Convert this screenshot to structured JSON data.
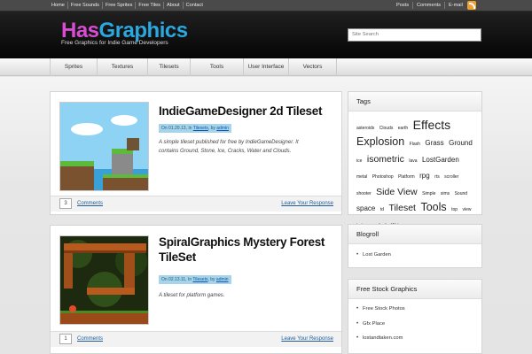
{
  "topnav": [
    "Home",
    "Free Sounds",
    "Free Sprites",
    "Free Tiles",
    "About",
    "Contact"
  ],
  "topnav_right": [
    "Posts",
    "Comments",
    "E-mail"
  ],
  "logo": {
    "part1": "Has",
    "part2": "Graphics",
    "tagline": "Free Graphics for Indie Game Developers"
  },
  "search": {
    "placeholder": "Site Search"
  },
  "nav": [
    "Sprites",
    "Textures",
    "Tilesets",
    "Tools",
    "User Interface",
    "Vectors"
  ],
  "posts": [
    {
      "title": "IndieGameDesigner 2d Tileset",
      "date": "On 01.20.13,",
      "in_label": "In",
      "category": "Tilesets",
      "by_label": ", by",
      "author": "admin",
      "excerpt": "A simple tileset published for free by IndieGameDesigner. It contains Ground, Stone, Ice, Cracks, Water and Clouds.",
      "comment_count": "3",
      "comments_label": "Comments",
      "leave_label": "Leave Your Response"
    },
    {
      "title": "SpiralGraphics Mystery Forest TileSet",
      "date": "On 02.13.11,",
      "in_label": "In",
      "category": "Tilesets",
      "by_label": ", by",
      "author": "admin",
      "excerpt": "A tileset for platform games.",
      "comment_count": "1",
      "comments_label": "Comments",
      "leave_label": "Leave Your Response"
    }
  ],
  "sidebar": {
    "tags_title": "Tags",
    "tags": [
      {
        "t": "asteroids",
        "s": 1
      },
      {
        "t": "Clouds",
        "s": 1
      },
      {
        "t": "earth",
        "s": 1
      },
      {
        "t": "Effects",
        "s": 5
      },
      {
        "t": "Explosion",
        "s": 4
      },
      {
        "t": "Flash",
        "s": 1
      },
      {
        "t": "Grass",
        "s": 2
      },
      {
        "t": "Ground",
        "s": 2
      },
      {
        "t": "ice",
        "s": 1
      },
      {
        "t": "isometric",
        "s": 3
      },
      {
        "t": "lava",
        "s": 1
      },
      {
        "t": "LostGarden",
        "s": 2
      },
      {
        "t": "metal",
        "s": 1
      },
      {
        "t": "Photoshop",
        "s": 1
      },
      {
        "t": "Platform",
        "s": 1
      },
      {
        "t": "rpg",
        "s": 2
      },
      {
        "t": "rts",
        "s": 1
      },
      {
        "t": "scroller",
        "s": 1
      },
      {
        "t": "shooter",
        "s": 1
      },
      {
        "t": "Side View",
        "s": 3
      },
      {
        "t": "Simple",
        "s": 1
      },
      {
        "t": "sims",
        "s": 1
      },
      {
        "t": "Sound",
        "s": 1
      },
      {
        "t": "space",
        "s": 2
      },
      {
        "t": "td",
        "s": 1
      },
      {
        "t": "Tileset",
        "s": 3
      },
      {
        "t": "Tools",
        "s": 4
      },
      {
        "t": "top",
        "s": 1
      },
      {
        "t": "view",
        "s": 1
      },
      {
        "t": "tyrian",
        "s": 1
      },
      {
        "t": "vertical",
        "s": 1
      },
      {
        "t": "Water",
        "s": 1
      }
    ],
    "blogroll_title": "Blogroll",
    "blogroll": [
      "Lost Garden"
    ],
    "stock_title": "Free Stock Graphics",
    "stock": [
      "Free Stock Photos",
      "Gfx Place",
      "lostandtaken.com"
    ]
  },
  "colors": {
    "logo_pink": "#d84bd3",
    "logo_blue": "#2aa8e0",
    "meta_bg": "#a7d4ea",
    "link": "#1e5d9a"
  }
}
